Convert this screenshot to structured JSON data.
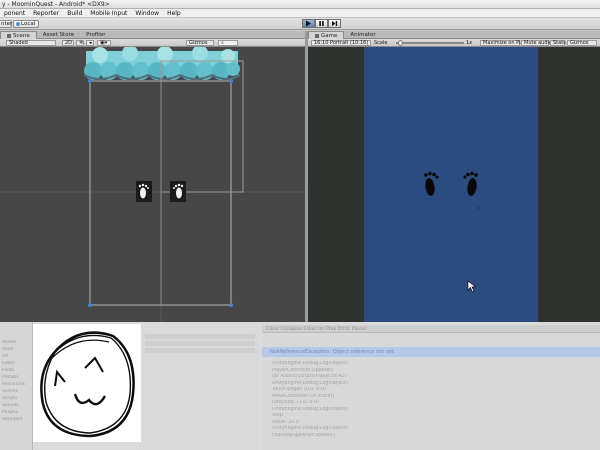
{
  "window": {
    "title": "y - MoominQuest - Android* <DX9>"
  },
  "menu": {
    "items": [
      "ponent",
      "Reporter",
      "Build",
      "Mobile Input",
      "Window",
      "Help"
    ]
  },
  "toolbar": {
    "pivot_label": "nter",
    "space_label": "Local",
    "play_icon": "play-icon",
    "pause_icon": "pause-icon",
    "step_icon": "step-icon"
  },
  "scene_panel": {
    "tabs": [
      "Scene",
      "Asset Store",
      "Profiler"
    ],
    "shading": "Shaded",
    "mode_2d": "2D",
    "gizmos": "Gizmos"
  },
  "game_panel": {
    "tabs": [
      "Game",
      "Animator"
    ],
    "aspect": "16:10 Portrait (10:16)",
    "scale_label": "Scale",
    "scale_value": "1x",
    "maximize": "Maximize on Play",
    "mute": "Mute audio",
    "stats": "Stats",
    "gizmos": "Gizmos"
  },
  "project_panel": {
    "rows": [
      "Assets",
      "Anim",
      "Art",
      "Editor",
      "Fonts",
      "Prefabs",
      "Resources",
      "Scenes",
      "Scripts",
      "Sounds",
      "Plugins",
      "Standard"
    ]
  },
  "console": {
    "header": "Clear  Collapse  Clear on Play  Error Pause",
    "selected": "NullReferenceException: Object reference not set",
    "lines": [
      "UnityEngine.Debug:Log(Object)",
      "PlayerController:Update()",
      "  (at Assets/Scripts/Player.cs:42)",
      "UnityEngine.Debug:Log(Object)",
      "  Touch began (0.0, 0.0)",
      "MoveController:OnTouch()",
      "  Direction: (1.0, 0.0)",
      "UnityEngine.Debug:Log(Object)",
      "  Step",
      "  value: 10.0",
      "UnityEngine.Debug:Log(Object)",
      "FootstepSpawner:Spawn()"
    ]
  },
  "colors": {
    "scene_bg": "#474747",
    "game_bg": "#2c4b7e",
    "cloud": "#7fd0d8"
  }
}
